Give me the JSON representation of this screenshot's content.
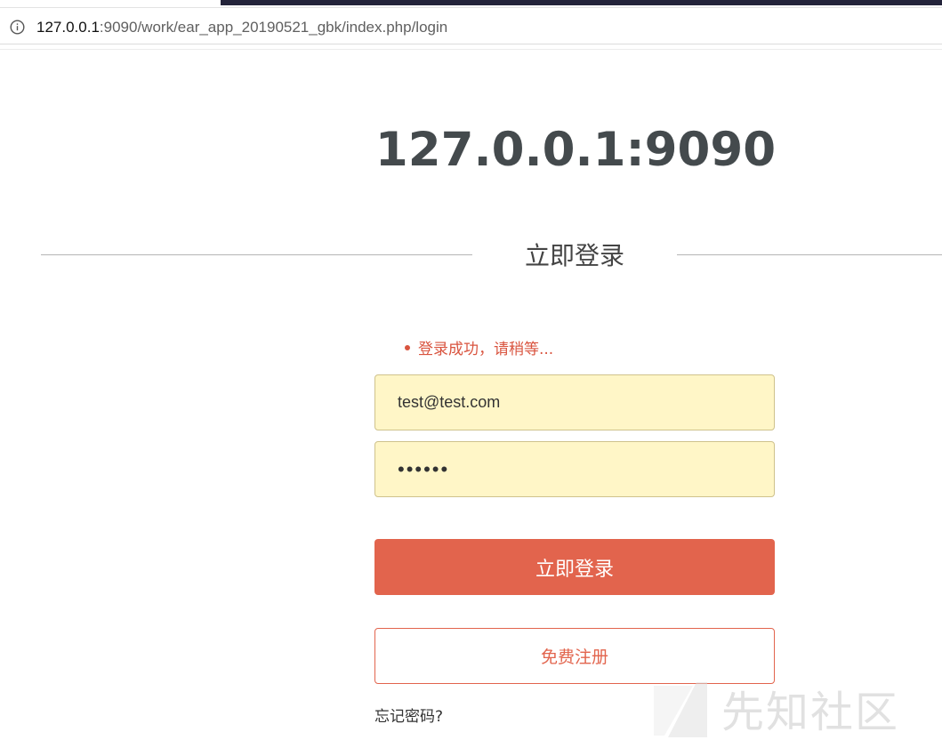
{
  "browser": {
    "url_host": "127.0.0.1",
    "url_path": ":9090/work/ear_app_20190521_gbk/index.php/login"
  },
  "page": {
    "site_title": "127.0.0.1:9090",
    "section_heading": "立即登录"
  },
  "form": {
    "status_message": "登录成功，请稍等...",
    "email_value": "test@test.com",
    "password_value": "••••••",
    "login_label": "立即登录",
    "register_label": "免费注册",
    "forgot_label": "忘记密码?"
  },
  "watermark": {
    "text": "先知社区"
  },
  "colors": {
    "accent": "#e2644d",
    "autofill_bg": "#fff6c7",
    "title_text": "#444a4d"
  }
}
